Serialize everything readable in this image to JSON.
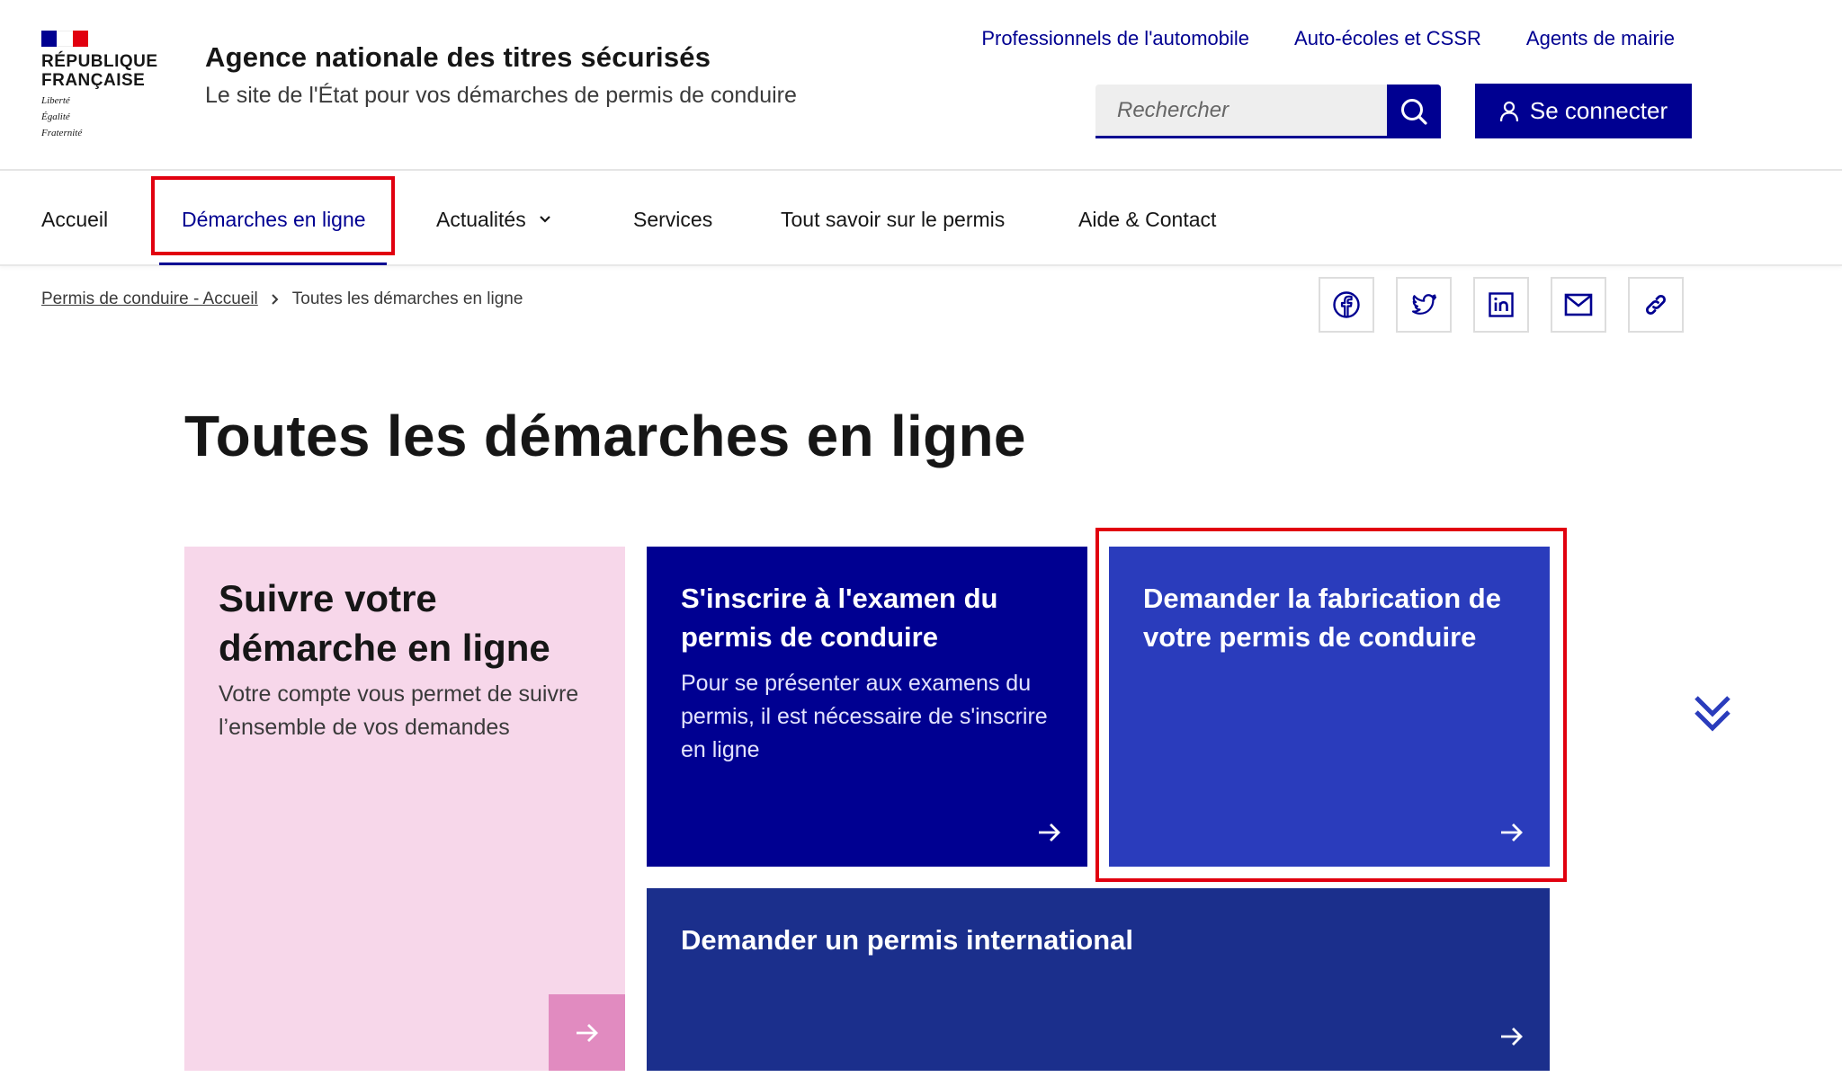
{
  "header": {
    "logo": {
      "name_line1": "République",
      "name_line2": "Française",
      "motto1": "Liberté",
      "motto2": "Égalité",
      "motto3": "Fraternité"
    },
    "site_title": "Agence nationale des titres sécurisés",
    "site_tagline": "Le site de l'État pour vos démarches de permis de conduire",
    "top_links": [
      "Professionnels de l'automobile",
      "Auto-écoles et CSSR",
      "Agents de mairie"
    ],
    "search": {
      "placeholder": "Rechercher",
      "icon": "search-icon"
    },
    "login_label": "Se connecter"
  },
  "nav": {
    "items": [
      {
        "label": "Accueil"
      },
      {
        "label": "Démarches en ligne",
        "active": true
      },
      {
        "label": "Actualités",
        "has_dropdown": true
      },
      {
        "label": "Services"
      },
      {
        "label": "Tout savoir sur le permis"
      },
      {
        "label": "Aide & Contact"
      }
    ]
  },
  "breadcrumb": {
    "home": "Permis de conduire - Accueil",
    "current": "Toutes les démarches en ligne"
  },
  "share": [
    "facebook-icon",
    "twitter-icon",
    "linkedin-icon",
    "mail-icon",
    "link-icon"
  ],
  "page_title": "Toutes les démarches en ligne",
  "tiles": [
    {
      "title": "Suivre votre démarche en ligne",
      "description": "Votre compte vous permet de suivre l’ensemble de vos demandes",
      "color": "#f7d7ea"
    },
    {
      "title": "S'inscrire à l'examen du permis de conduire",
      "description": "Pour se présenter aux examens du permis, il est nécessaire de s'inscrire en ligne",
      "color": "#000091"
    },
    {
      "title": "Demander la fabrication de votre permis de conduire",
      "color": "#2a3cbc"
    },
    {
      "title": "Demander un permis international",
      "color": "#1b2f8c"
    }
  ],
  "colors": {
    "brand_blue": "#000091",
    "highlight_red": "#e1000f",
    "pink_accent": "#e18bc0"
  }
}
